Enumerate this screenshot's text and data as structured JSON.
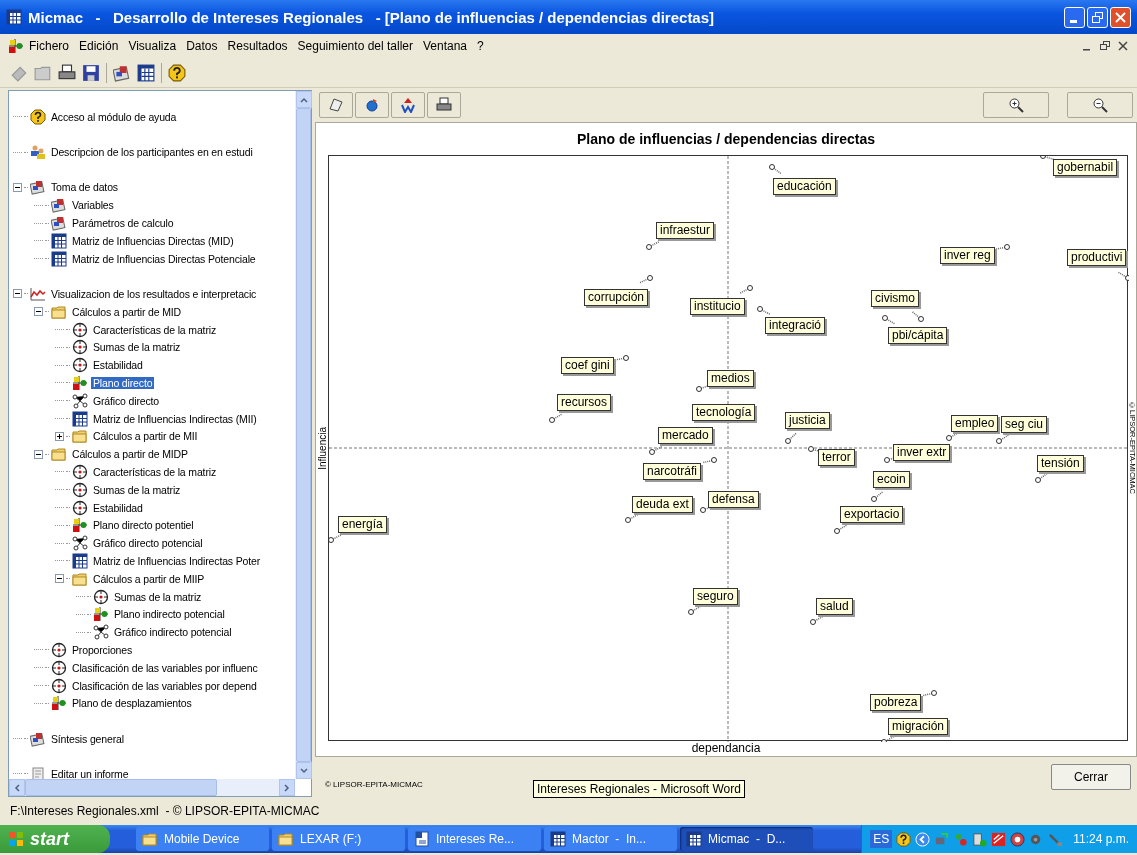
{
  "window": {
    "title": "Micmac   -   Desarrollo de Intereses Regionales   - [Plano de influencias / dependencias directas]"
  },
  "menu": [
    "Fichero",
    "Edición",
    "Visualiza",
    "Datos",
    "Resultados",
    "Seguimiento del taller",
    "Ventana",
    "?"
  ],
  "tree": [
    {
      "label": "Acceso al módulo de ayuda",
      "kind": "help",
      "selected": false
    },
    {
      "label": "Descripcion de los participantes en en estudi",
      "kind": "people",
      "selected": false
    },
    {
      "label": "Toma de datos",
      "kind": "data",
      "selected": false,
      "expanded": true,
      "children": [
        {
          "label": "Variables",
          "kind": "data",
          "selected": false
        },
        {
          "label": "Parámetros de calculo",
          "kind": "data",
          "selected": false
        },
        {
          "label": "Matriz de Influencias Directas (MID)",
          "kind": "table",
          "selected": false
        },
        {
          "label": "Matriz de Influencias Directas Potenciale",
          "kind": "table",
          "selected": false
        }
      ]
    },
    {
      "label": "Visualizacion de los resultados e interpretacic",
      "kind": "chart",
      "selected": false,
      "expanded": true,
      "children": [
        {
          "label": "Cálculos a partir de MID",
          "kind": "folder",
          "selected": false,
          "expanded": true,
          "children": [
            {
              "label": "Características de la matriz",
              "kind": "target",
              "selected": false
            },
            {
              "label": "Sumas de la matriz",
              "kind": "target",
              "selected": false
            },
            {
              "label": "Estabilidad",
              "kind": "target",
              "selected": false
            },
            {
              "label": "Plano directo",
              "kind": "plane",
              "selected": true
            },
            {
              "label": "Gráfico directo",
              "kind": "graph",
              "selected": false
            },
            {
              "label": "Matriz de Influencias Indirectas (MII)",
              "kind": "table",
              "selected": false
            },
            {
              "label": "Cálculos a partir de MII",
              "kind": "folder",
              "selected": false,
              "expanded": false
            }
          ]
        },
        {
          "label": "Cálculos a partir de MIDP",
          "kind": "folder",
          "selected": false,
          "expanded": true,
          "children": [
            {
              "label": "Características de la matriz",
              "kind": "target",
              "selected": false
            },
            {
              "label": "Sumas de la matriz",
              "kind": "target",
              "selected": false
            },
            {
              "label": "Estabilidad",
              "kind": "target",
              "selected": false
            },
            {
              "label": "Plano directo potentiel",
              "kind": "plane",
              "selected": false
            },
            {
              "label": "Gráfico directo potencial",
              "kind": "graph",
              "selected": false
            },
            {
              "label": "Matriz de Influencias Indirectas Poter",
              "kind": "table",
              "selected": false
            },
            {
              "label": "Cálculos a partir de MIIP",
              "kind": "folder",
              "selected": false,
              "expanded": true,
              "children": [
                {
                  "label": "Sumas de la matriz",
                  "kind": "target",
                  "selected": false
                },
                {
                  "label": "Plano indirecto potencial",
                  "kind": "plane",
                  "selected": false
                },
                {
                  "label": "Gráfico indirecto potencial",
                  "kind": "graph",
                  "selected": false
                }
              ]
            }
          ]
        },
        {
          "label": "Proporciones",
          "kind": "target",
          "selected": false
        },
        {
          "label": "Clasificación de las variables por influenc",
          "kind": "target",
          "selected": false
        },
        {
          "label": "Clasificación de las variables por depend",
          "kind": "target",
          "selected": false
        },
        {
          "label": "Plano de desplazamientos",
          "kind": "plane",
          "selected": false
        }
      ]
    },
    {
      "label": "Síntesis general",
      "kind": "data",
      "selected": false
    },
    {
      "label": "Editar un informe",
      "kind": "report",
      "selected": false
    }
  ],
  "chart_panel": {
    "title": "Plano de influencias / dependencias directas",
    "y_axis_label": "Influencia",
    "x_axis_label": "dependancia",
    "side_credit": "©LIPSOR-EPITA-MICMAC",
    "points": [
      "gobernabil",
      "educación",
      "infraestur",
      "inver reg",
      "productivi",
      "corrupción",
      "institucio",
      "integració",
      "civismo",
      "pbi/cápita",
      "coef gini",
      "medios",
      "recursos",
      "tecnología",
      "justicia",
      "empleo",
      "seg ciu",
      "mercado",
      "terror",
      "inver extr",
      "tensión",
      "narcotráfi",
      "ecoin",
      "deuda ext",
      "defensa",
      "exportacio",
      "energía",
      "seguro",
      "salud",
      "pobreza",
      "migración"
    ]
  },
  "footer": {
    "credit": "© LIPSOR-EPITA-MICMAC",
    "close_button": "Cerrar"
  },
  "status_bar": "F:\\Intereses Regionales.xml  - © LIPSOR-EPITA-MICMAC",
  "tooltip": "Intereses Regionales - Microsoft Word",
  "taskbar": {
    "start": "start",
    "buttons": [
      {
        "label": "Mobile Device",
        "kind": "folder",
        "selected": false
      },
      {
        "label": "LEXAR (F:)",
        "kind": "folder",
        "selected": false
      },
      {
        "label": "Intereses Re...",
        "kind": "document",
        "selected": false
      },
      {
        "label": "Mactor  -  In...",
        "kind": "table",
        "selected": false
      },
      {
        "label": "Micmac  -  D...",
        "kind": "table",
        "selected": true
      }
    ],
    "language": "ES",
    "clock": "11:24 p.m."
  }
}
